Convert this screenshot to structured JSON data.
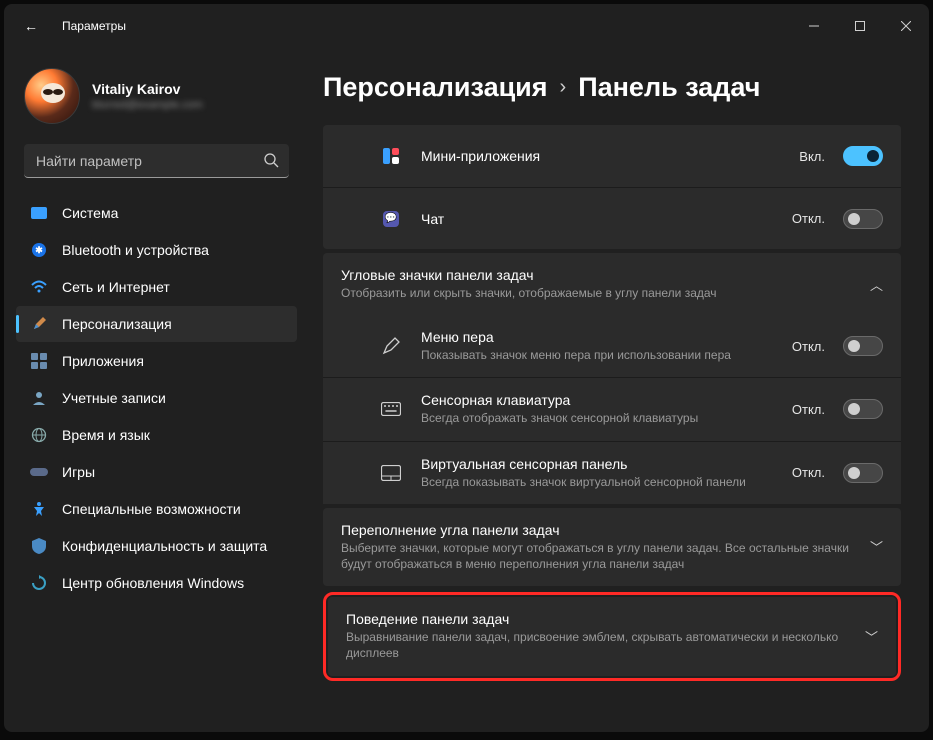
{
  "window": {
    "title": "Параметры"
  },
  "profile": {
    "name": "Vitaliy Kairov",
    "email": "blurred@example.com"
  },
  "search": {
    "placeholder": "Найти параметр"
  },
  "nav": {
    "items": [
      {
        "label": "Система",
        "icon": "💻"
      },
      {
        "label": "Bluetooth и устройства",
        "icon": "bt"
      },
      {
        "label": "Сеть и Интернет",
        "icon": "wifi"
      },
      {
        "label": "Персонализация",
        "icon": "🖌",
        "active": true
      },
      {
        "label": "Приложения",
        "icon": "apps"
      },
      {
        "label": "Учетные записи",
        "icon": "👤"
      },
      {
        "label": "Время и язык",
        "icon": "🌐"
      },
      {
        "label": "Игры",
        "icon": "🎮"
      },
      {
        "label": "Специальные возможности",
        "icon": "acc"
      },
      {
        "label": "Конфиденциальность и защита",
        "icon": "🛡"
      },
      {
        "label": "Центр обновления Windows",
        "icon": "↻"
      }
    ]
  },
  "breadcrumb": {
    "parent": "Персонализация",
    "current": "Панель задач"
  },
  "rows": {
    "widgets": {
      "title": "Мини-приложения",
      "state": "Вкл.",
      "on": true
    },
    "chat": {
      "title": "Чат",
      "state": "Откл.",
      "on": false
    }
  },
  "cornerIcons": {
    "title": "Угловые значки панели задач",
    "sub": "Отобразить или скрыть значки, отображаемые в углу панели задач",
    "pen": {
      "title": "Меню пера",
      "sub": "Показывать значок меню пера при использовании пера",
      "state": "Откл."
    },
    "touchkb": {
      "title": "Сенсорная клавиатура",
      "sub": "Всегда отображать значок сенсорной клавиатуры",
      "state": "Откл."
    },
    "touchpad": {
      "title": "Виртуальная сенсорная панель",
      "sub": "Всегда показывать значок виртуальной сенсорной панели",
      "state": "Откл."
    }
  },
  "overflow": {
    "title": "Переполнение угла панели задач",
    "sub": "Выберите значки, которые могут отображаться в углу панели задач. Все остальные значки будут отображаться в меню переполнения угла панели задач"
  },
  "behavior": {
    "title": "Поведение панели задач",
    "sub": "Выравнивание панели задач, присвоение эмблем, скрывать автоматически и несколько дисплеев"
  }
}
